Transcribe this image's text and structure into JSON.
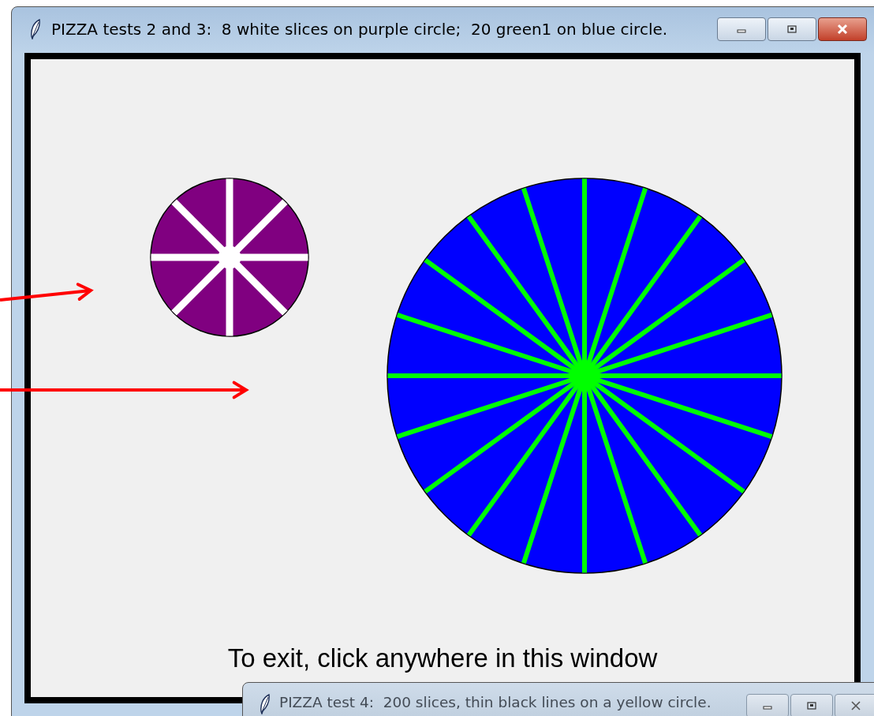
{
  "windows": [
    {
      "title": "PIZZA tests 2 and 3:  8 white slices on purple circle;  20 green1 on blue circle.",
      "active": true,
      "canvas": {
        "pizzas": [
          {
            "kind": "small",
            "color": "#800080",
            "slices": {
              "color": "#ffffff"
            }
          },
          {
            "kind": "large",
            "color": "#0000ff",
            "slices": {
              "color": "#00ff00"
            }
          }
        ],
        "message": "To exit, click anywhere in this window"
      }
    },
    {
      "title": "PIZZA test 4:  200 slices, thin black lines on a yellow circle.",
      "active": false
    }
  ],
  "annotations": [
    {
      "kind": "arrow",
      "color": "#ff0000"
    },
    {
      "kind": "arrow",
      "color": "#ff0000"
    }
  ]
}
